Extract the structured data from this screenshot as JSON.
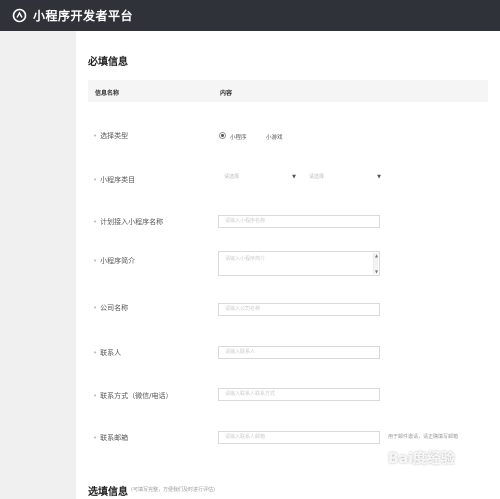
{
  "header": {
    "title": "小程序开发者平台",
    "bg_color": "#2f3238"
  },
  "required_section": {
    "title": "必填信息",
    "table_head": {
      "col_name": "信息名称",
      "col_content": "内容"
    },
    "rows": {
      "type": {
        "label": "选择类型",
        "options": [
          "小程序",
          "小游戏"
        ],
        "selected": "小程序"
      },
      "category": {
        "label": "小程序类目",
        "select1_value": "请选择",
        "select2_value": "请选择"
      },
      "name": {
        "label": "计划接入小程序名称",
        "placeholder": "请输入小程序名称"
      },
      "intro": {
        "label": "小程序简介",
        "placeholder": "请输入小程序简介"
      },
      "company": {
        "label": "公司名称",
        "placeholder": "请输入公司名称"
      },
      "contact": {
        "label": "联系人",
        "placeholder": "请输入联系人"
      },
      "contact_method": {
        "label": "联系方式（微信/电话）",
        "placeholder": "请输入联系人联系方式"
      },
      "email": {
        "label": "联系邮箱",
        "placeholder": "请输入联系人邮箱",
        "hint": "用于邮件邀请，请正确填写邮箱"
      }
    }
  },
  "optional_section": {
    "title": "选填信息",
    "note": "(可填写完整，方便我们及时进行评估)"
  },
  "watermark": "Bai度经验"
}
